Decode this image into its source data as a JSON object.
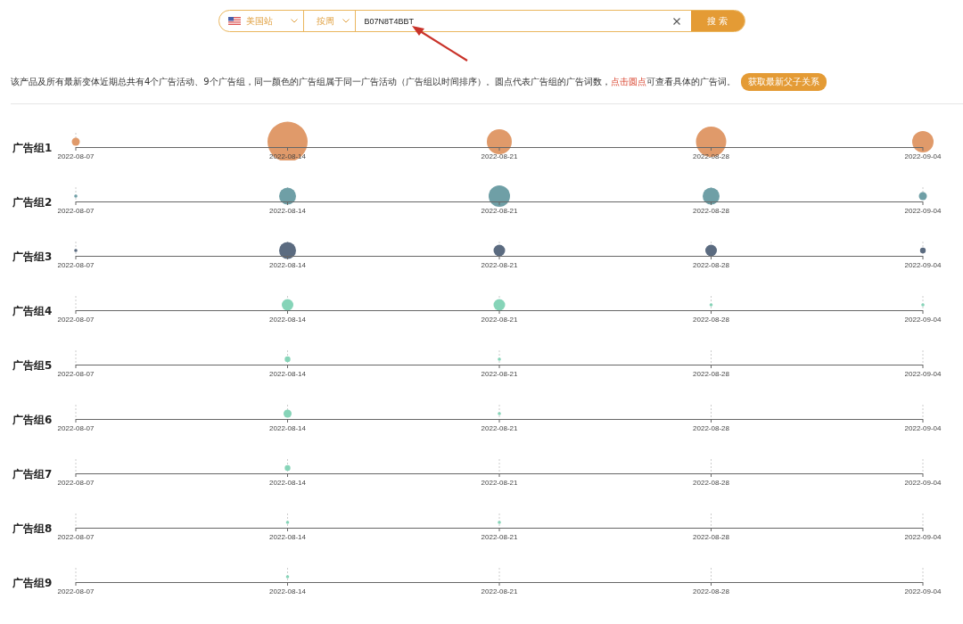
{
  "search": {
    "site": "美国站",
    "period": "按周",
    "value": "B07N8T4BBT",
    "button": "搜 索"
  },
  "notice": {
    "before": "该产品及所有最新变体近期总共有4个广告活动、9个广告组，同一颜色的广告组属于同一广告活动（广告组以时间排序）。圆点代表广告组的广告词数，",
    "link": "点击圆点",
    "after": "可查看具体的广告词。",
    "button": "获取最新父子关系"
  },
  "groups": [
    {
      "name": "广告组1",
      "color": "#e09a6a",
      "points": [
        {
          "date": "2022-08-07",
          "kind": "tiny"
        },
        {
          "date": "2022-08-14",
          "kind": "huge"
        },
        {
          "date": "2022-08-21",
          "kind": "big"
        },
        {
          "date": "2022-08-28",
          "kind": "xlarge"
        },
        {
          "date": "2022-09-04",
          "kind": "large"
        }
      ]
    },
    {
      "name": "广告组2",
      "color": "#6f9fa6",
      "points": [
        {
          "date": "2022-08-07",
          "kind": "speck"
        },
        {
          "date": "2022-08-14",
          "kind": "medium"
        },
        {
          "date": "2022-08-21",
          "kind": "large"
        },
        {
          "date": "2022-08-28",
          "kind": "medium"
        },
        {
          "date": "2022-09-04",
          "kind": "tiny"
        }
      ]
    },
    {
      "name": "广告组3",
      "color": "#5b6b80",
      "points": [
        {
          "date": "2022-08-07",
          "kind": "speck"
        },
        {
          "date": "2022-08-14",
          "kind": "medium"
        },
        {
          "date": "2022-08-21",
          "kind": "small"
        },
        {
          "date": "2022-08-28",
          "kind": "small"
        },
        {
          "date": "2022-09-04",
          "kind": "dot"
        }
      ]
    },
    {
      "name": "广告组4",
      "color": "#86d4b8",
      "points": [
        {
          "date": "2022-08-07",
          "kind": "none"
        },
        {
          "date": "2022-08-14",
          "kind": "small"
        },
        {
          "date": "2022-08-21",
          "kind": "small"
        },
        {
          "date": "2022-08-28",
          "kind": "speck"
        },
        {
          "date": "2022-09-04",
          "kind": "speck"
        }
      ]
    },
    {
      "name": "广告组5",
      "color": "#86d4b8",
      "points": [
        {
          "date": "2022-08-07",
          "kind": "none"
        },
        {
          "date": "2022-08-14",
          "kind": "dot"
        },
        {
          "date": "2022-08-21",
          "kind": "speck"
        },
        {
          "date": "2022-08-28",
          "kind": "none"
        },
        {
          "date": "2022-09-04",
          "kind": "none"
        }
      ]
    },
    {
      "name": "广告组6",
      "color": "#86d4b8",
      "points": [
        {
          "date": "2022-08-07",
          "kind": "none"
        },
        {
          "date": "2022-08-14",
          "kind": "tiny"
        },
        {
          "date": "2022-08-21",
          "kind": "speck"
        },
        {
          "date": "2022-08-28",
          "kind": "none"
        },
        {
          "date": "2022-09-04",
          "kind": "none"
        }
      ]
    },
    {
      "name": "广告组7",
      "color": "#86d4b8",
      "points": [
        {
          "date": "2022-08-07",
          "kind": "none"
        },
        {
          "date": "2022-08-14",
          "kind": "dot"
        },
        {
          "date": "2022-08-21",
          "kind": "none"
        },
        {
          "date": "2022-08-28",
          "kind": "none"
        },
        {
          "date": "2022-09-04",
          "kind": "none"
        }
      ]
    },
    {
      "name": "广告组8",
      "color": "#86d4b8",
      "points": [
        {
          "date": "2022-08-07",
          "kind": "none"
        },
        {
          "date": "2022-08-14",
          "kind": "speck"
        },
        {
          "date": "2022-08-21",
          "kind": "speck"
        },
        {
          "date": "2022-08-28",
          "kind": "none"
        },
        {
          "date": "2022-09-04",
          "kind": "none"
        }
      ]
    },
    {
      "name": "广告组9",
      "color": "#86d4b8",
      "points": [
        {
          "date": "2022-08-07",
          "kind": "none"
        },
        {
          "date": "2022-08-14",
          "kind": "speck"
        },
        {
          "date": "2022-08-21",
          "kind": "none"
        },
        {
          "date": "2022-08-28",
          "kind": "none"
        },
        {
          "date": "2022-09-04",
          "kind": "none"
        }
      ]
    }
  ]
}
